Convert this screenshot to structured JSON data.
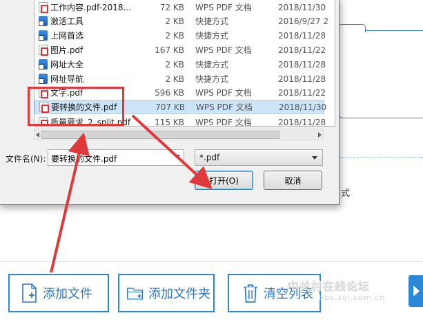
{
  "dialog": {
    "files": [
      {
        "name": "工作内容.pdf-2018...",
        "size": "72 KB",
        "type": "WPS PDF 文档",
        "date": "2018/11/30",
        "icon": "pdf-file-icon"
      },
      {
        "name": "激活工具",
        "size": "2 KB",
        "type": "快捷方式",
        "date": "2016/9/27 2",
        "icon": "shortcut-icon"
      },
      {
        "name": "上网首选",
        "size": "2 KB",
        "type": "快捷方式",
        "date": "2018/11/28",
        "icon": "shortcut-icon"
      },
      {
        "name": "图片.pdf",
        "size": "167 KB",
        "type": "WPS PDF 文档",
        "date": "2018/11/22",
        "icon": "pdf-file-icon"
      },
      {
        "name": "网址大全",
        "size": "2 KB",
        "type": "快捷方式",
        "date": "2018/11/28",
        "icon": "shortcut-icon"
      },
      {
        "name": "网址导航",
        "size": "2 KB",
        "type": "快捷方式",
        "date": "2018/11/28",
        "icon": "shortcut-icon"
      },
      {
        "name": "文字.pdf",
        "size": "596 KB",
        "type": "WPS PDF 文档",
        "date": "2018/11/22",
        "icon": "pdf-file-icon"
      },
      {
        "name": "要转换的文件.pdf",
        "size": "707 KB",
        "type": "WPS PDF 文档",
        "date": "2018/11/30",
        "icon": "pdf-file-icon",
        "selected": true
      },
      {
        "name": "质量要求_2_split.pdf",
        "size": "115 KB",
        "type": "WPS PDF 文档",
        "date": "2018/11/28",
        "icon": "pdf-file-icon"
      }
    ],
    "filename_label": "文件名(N):",
    "filename_value": "要转换的文件.pdf",
    "filter_value": "*.pdf",
    "open_button": "打开(O)",
    "cancel_button": "取消"
  },
  "background_app": {
    "fragment_text": "式",
    "buttons": {
      "add_file": "添加文件",
      "add_folder": "添加文件夹",
      "clear_list": "清空列表"
    },
    "watermark": "中关村在线论坛",
    "watermark_url": "bbs.zol.com.cn"
  },
  "colors": {
    "annotation_red": "#e0393b",
    "accent_blue": "#2a88d6",
    "selection_bg": "#cce4f7"
  }
}
